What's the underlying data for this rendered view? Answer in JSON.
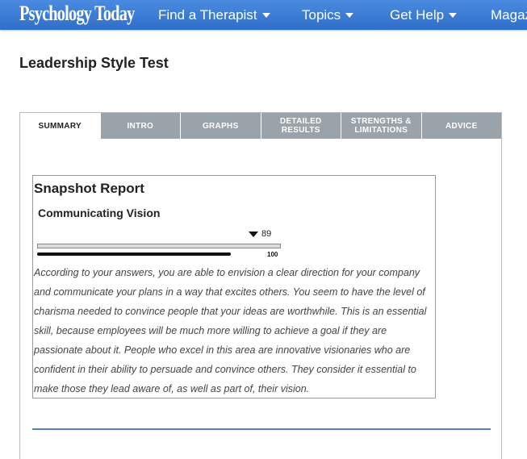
{
  "header": {
    "logo": "Psychology Today",
    "nav": [
      "Find a Therapist",
      "Topics",
      "Get Help",
      "Magazine"
    ]
  },
  "page": {
    "title": "Leadership Style Test"
  },
  "tabs": [
    {
      "label": "SUMMARY",
      "active": true
    },
    {
      "label": "INTRO",
      "active": false
    },
    {
      "label": "GRAPHS",
      "active": false
    },
    {
      "label": "DETAILED RESULTS",
      "active": false
    },
    {
      "label": "STRENGTHS & LIMITATIONS",
      "active": false
    },
    {
      "label": "ADVICE",
      "active": false
    }
  ],
  "report": {
    "title": "Snapshot Report",
    "section": "Communicating Vision",
    "score": "89",
    "scale_max": "100",
    "score_fraction": 0.89,
    "description": "According to your answers, you are able to envision a clear direction for your company and communicate your plans in a way that excites others. You seem to have the level of charisma needed to convince people that your ideas are worthwhile. This is an essential skill, because employees will be much more willing to achieve a goal if they are passionate about it. People who excel in this area are innovative visionaries who are confident in their ability to persuade and convince others. They consider it essential to make those they lead aware of, as well as part of, their vision."
  },
  "colors": {
    "header_blue": "#3a7bd5",
    "tab_gray": "#9aa3aa",
    "divider_blue": "#5b7fb8"
  }
}
